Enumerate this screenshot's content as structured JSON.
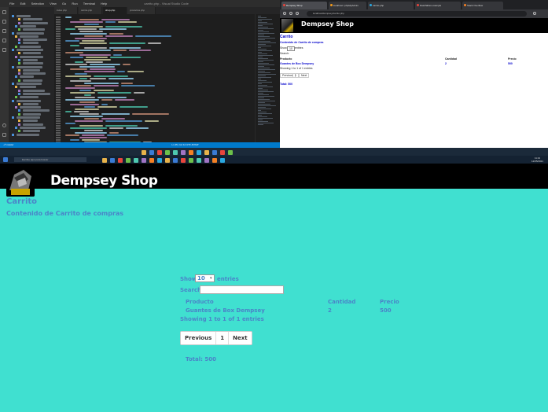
{
  "vscode": {
    "menu": [
      "File",
      "Edit",
      "Selection",
      "View",
      "Go",
      "Run",
      "Terminal",
      "Help"
    ],
    "window_title": "carrito.php - Visual Studio Code",
    "tabs": [
      "index.php",
      "carrito.php",
      "shop.php",
      "productos.php"
    ],
    "active_tab_index": 1,
    "status_left": "⎇ master",
    "status_right": "Ln 45, Col 12   UTF-8   PHP"
  },
  "mini_browser": {
    "tabs": [
      {
        "label": "Dempsey Shop",
        "color": "#e8453c"
      },
      {
        "label": "localhost / phpMyAdmin",
        "color": "#f29b1b"
      },
      {
        "label": "carrito.php",
        "color": "#2aa8e0"
      },
      {
        "label": "DataTables example",
        "color": "#e8453c"
      },
      {
        "label": "Stack Overflow",
        "color": "#f48024"
      }
    ],
    "url": "localhost/dempsey/carrito.php",
    "brand": "Dempsey Shop",
    "heading": "Carrito",
    "subheading": "Contenido de Carrito de compras",
    "show_label": "Show",
    "show_value": "10",
    "entries_label": "entries",
    "search_label": "Search:",
    "col_producto": "Producto",
    "col_cantidad": "Cantidad",
    "col_precio": "Precio",
    "row_producto": "Guantes de Box Dempsey",
    "row_cantidad": "2",
    "row_precio": "500",
    "info": "Showing 1 to 1 of 1 entries",
    "prev": "Previous",
    "page": "1",
    "next": "Next",
    "total": "Total: 500"
  },
  "taskbar": {
    "search_placeholder": "Escribe aquí para buscar",
    "time": "11:42",
    "date": "12/05/2021"
  },
  "page": {
    "brand": "Dempsey Shop",
    "heading": "Carrito",
    "subheading": "Contenido de Carrito de compras",
    "show_label": "Show",
    "show_value": "10",
    "entries_label": "entries",
    "search_label": "Search:",
    "table": {
      "headers": {
        "producto": "Producto",
        "cantidad": "Cantidad",
        "precio": "Precio"
      },
      "rows": [
        {
          "producto": "Guantes de Box Dempsey",
          "cantidad": "2",
          "precio": "500"
        }
      ]
    },
    "info": "Showing 1 to 1 of 1 entries",
    "pagination": {
      "previous": "Previous",
      "page": "1",
      "next": "Next"
    },
    "total": "Total: 500"
  }
}
